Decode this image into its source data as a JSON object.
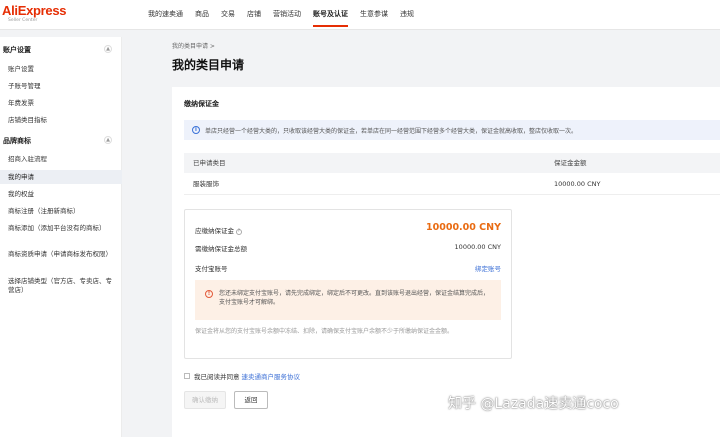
{
  "logo": {
    "brand": "AliExpress",
    "sub": "Seller Center"
  },
  "nav": [
    "我的速卖通",
    "商品",
    "交易",
    "店铺",
    "营销活动",
    "账号及认证",
    "生意参谋",
    "违规"
  ],
  "nav_active": 5,
  "sidebar": {
    "group1": "账户设置",
    "group1_items": [
      "账户设置",
      "子账号管理",
      "年费发票",
      "店铺类目指标"
    ],
    "group2": "品牌商标",
    "group2_items": [
      "招商入驻流程",
      "我的申请",
      "我的权益",
      "商标注册（注册新商标）",
      "商标添加（添加平台没有的商标）",
      "商标资质申请（申请商标发布权限）",
      "选择店铺类型（官方店、专卖店、专营店）"
    ],
    "active_item": "我的申请"
  },
  "breadcrumb": "我的类目申请  >",
  "page_title": "我的类目申请",
  "card": {
    "title": "缴纳保证金",
    "notice": "单店只经营一个经营大类的，只收取该经营大类的保证金，若单店在同一经营范围下经营多个经营大类，保证金就高收取，整店仅收取一次。",
    "table": {
      "headers": [
        "已申请类目",
        "保证金金额"
      ],
      "rows": [
        [
          "服装服饰",
          "10000.00 CNY"
        ]
      ]
    },
    "pay": {
      "due_label": "应缴纳保证金",
      "due_amount": "10000.00 CNY",
      "total_label": "需缴纳保证金总额",
      "total_value": "10000.00 CNY",
      "account_label": "支付宝账号",
      "bind_link": "绑定账号",
      "warning": "您还未绑定支付宝账号，请先完成绑定，绑定后不可更改。直到该账号退出经营，保证金结算完成后，支付宝账号才可解绑。",
      "note": "保证金将从您的支付宝账号余额中冻结、扣除，请确保支付宝账户余额不少于所缴纳保证金金额。"
    },
    "agree_text": "我已阅读并同意",
    "agree_link": "速卖通商户服务协议",
    "btn_confirm": "确认缴纳",
    "btn_back": "返回"
  },
  "watermark": "知乎 @Lazada速卖通coco"
}
